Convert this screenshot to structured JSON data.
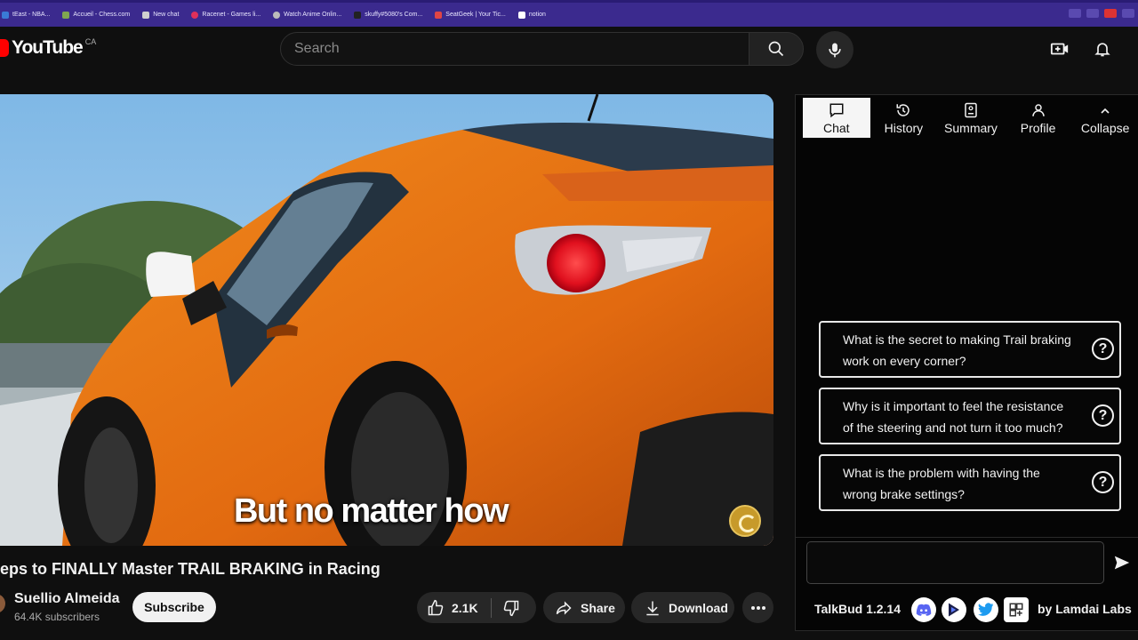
{
  "bookmarks": [
    {
      "label": "tEast - NBA...",
      "color": "#3a7bd5"
    },
    {
      "label": "Accueil - Chess.com",
      "color": "#7fa650"
    },
    {
      "label": "New chat",
      "color": "#cfcfcf"
    },
    {
      "label": "Racenet - Games li...",
      "color": "#e0305a"
    },
    {
      "label": "Watch Anime Onlin...",
      "color": "#bbbbbb"
    },
    {
      "label": "skuffy#5080's Com...",
      "color": "#222222"
    },
    {
      "label": "SeatGeek | Your Tic...",
      "color": "#e04545"
    },
    {
      "label": "notion",
      "color": "#ffffff"
    }
  ],
  "header": {
    "logo_text": "YouTube",
    "country_code": "CA",
    "search_placeholder": "Search"
  },
  "video": {
    "caption": "But no matter how",
    "title": "eps to FINALLY Master TRAIL BRAKING in Racing"
  },
  "channel": {
    "name": "Suellio Almeida",
    "subscribers": "64.4K subscribers",
    "subscribe_label": "Subscribe"
  },
  "actions": {
    "likes": "2.1K",
    "share_label": "Share",
    "download_label": "Download"
  },
  "talkbud": {
    "tabs": [
      {
        "label": "Chat",
        "icon": "chat-bubble-icon"
      },
      {
        "label": "History",
        "icon": "history-icon"
      },
      {
        "label": "Summary",
        "icon": "summary-icon"
      },
      {
        "label": "Profile",
        "icon": "profile-icon"
      },
      {
        "label": "Collapse",
        "icon": "chevron-up-icon"
      }
    ],
    "active_tab": "Chat",
    "questions": [
      "What is the secret to making Trail braking work on every corner?",
      "Why is it important to feel the resistance of the steering and not turn it too much?",
      "What is the problem with having the wrong brake settings?"
    ],
    "question_icon": "?",
    "version": "TalkBud 1.2.14",
    "brand": "by Lamdai Labs",
    "socials": [
      "discord-icon",
      "lamdai-icon",
      "twitter-icon",
      "puzzle-icon"
    ]
  }
}
